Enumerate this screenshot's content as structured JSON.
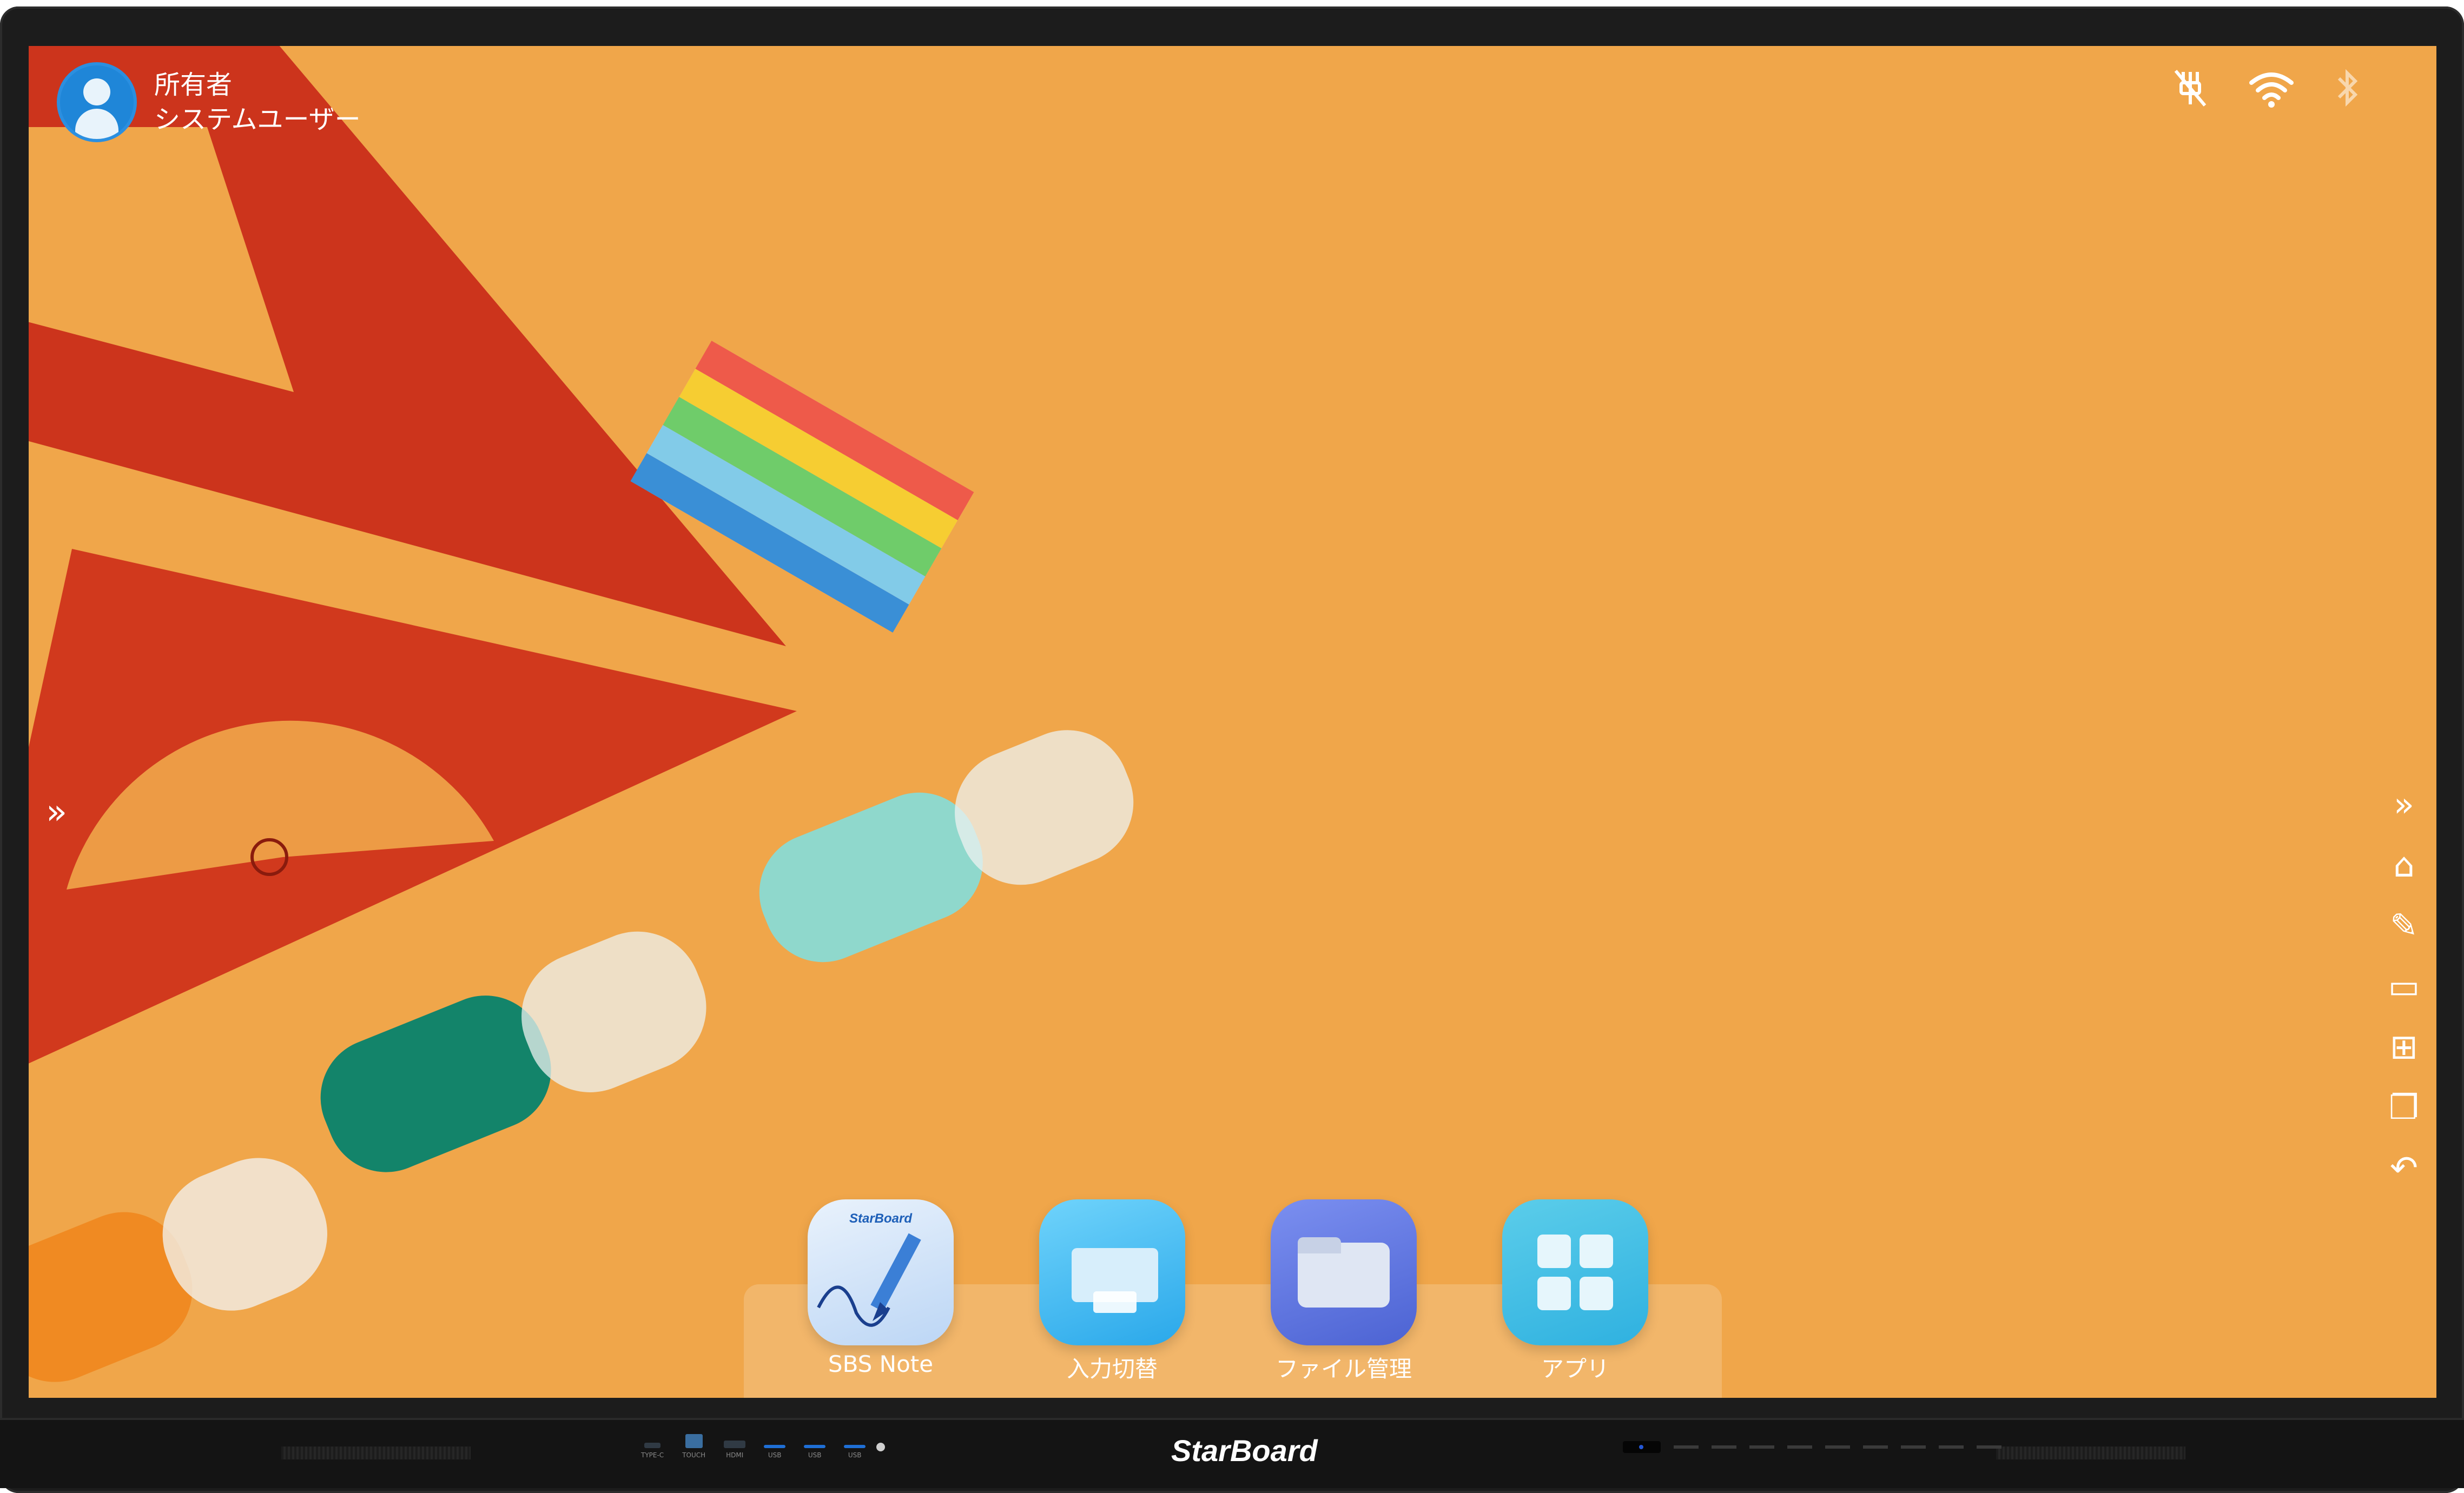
{
  "user": {
    "role": "所有者",
    "name": "システムユーザー"
  },
  "status_icons": [
    "ethernet-off-icon",
    "wifi-icon",
    "bluetooth-icon"
  ],
  "left_handle": {
    "icon": "double-chevron-right-icon",
    "glyph": "»"
  },
  "right_toolbar": [
    {
      "id": "expand",
      "icon": "double-chevron-right-icon",
      "glyph": "»"
    },
    {
      "id": "home",
      "icon": "home-icon",
      "glyph": "⌂"
    },
    {
      "id": "pen",
      "icon": "pencil-icon",
      "glyph": "✎"
    },
    {
      "id": "screen",
      "icon": "laptop-icon",
      "glyph": "▭"
    },
    {
      "id": "apps",
      "icon": "grid-icon",
      "glyph": "⊞"
    },
    {
      "id": "windows",
      "icon": "windows-icon",
      "glyph": "❐"
    },
    {
      "id": "back",
      "icon": "back-arrow-icon",
      "glyph": "↶"
    }
  ],
  "dock_apps": [
    {
      "label": "SBS Note",
      "icon_text": "StarBoard",
      "color": "#dbe9fb"
    },
    {
      "label": "入力切替",
      "color": "#39b9f0"
    },
    {
      "label": "ファイル管理",
      "color": "#5b74de"
    },
    {
      "label": "アプリ",
      "color": "#3fb9e6"
    }
  ],
  "brand": "StarBoard",
  "ports": [
    "TYPE-C",
    "TOUCH",
    "HDMI",
    "USB",
    "USB",
    "USB"
  ],
  "colors": {
    "wallpaper": "#f0a64a",
    "bezel": "#1c1c1c",
    "accent_blue": "#1f86d8"
  }
}
